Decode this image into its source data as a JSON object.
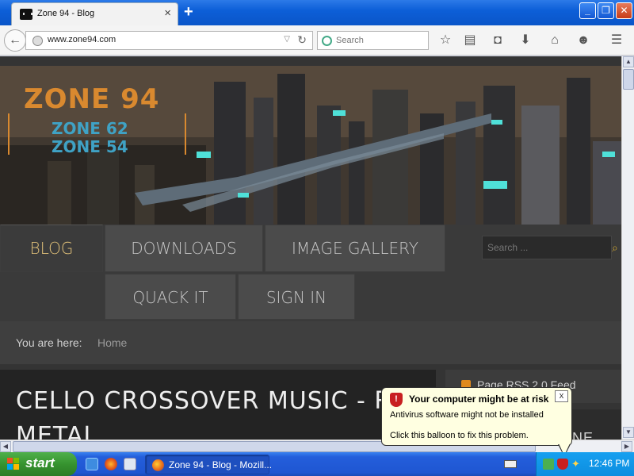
{
  "browser": {
    "tab_title": "Zone 94 - Blog",
    "tab_close": "×",
    "new_tab": "+",
    "url": "www.zone94.com",
    "search_placeholder": "Search",
    "window_buttons": {
      "minimize": "_",
      "maximize": "❐",
      "close": "✕"
    },
    "toolbar_icons": [
      "star-icon",
      "reading-list-icon",
      "pocket-icon",
      "download-icon",
      "home-icon",
      "smiley-icon",
      "menu-icon"
    ]
  },
  "site": {
    "logo": {
      "main": "ZONE 94",
      "sub1": "ZONE 62",
      "sub2": "ZONE 54"
    },
    "menu": {
      "row1": [
        "BLOG",
        "DOWNLOADS",
        "IMAGE GALLERY"
      ],
      "row2": [
        "QUACK IT",
        "SIGN IN"
      ],
      "active": "BLOG"
    },
    "search_placeholder": "Search ...",
    "breadcrumb": {
      "label": "You are here:",
      "current": "Home"
    },
    "article_title_line1": "CELLO CROSSOVER MUSIC - ROCK A",
    "article_title_line2": "METAL",
    "side_box": {
      "rss_text": "Page RSS 2.0 Feed"
    },
    "side_box2_text": "NE"
  },
  "balloon": {
    "title": "Your computer might be at risk",
    "line1": "Antivirus software might not be installed",
    "line2": "Click this balloon to fix this problem.",
    "close": "x"
  },
  "taskbar": {
    "start_label": "start",
    "task_label": "Zone 94 - Blog - Mozill...",
    "clock": "12:46 PM"
  },
  "colors": {
    "titlebar": "#0d5fd8",
    "active_menu": "#e2c27a",
    "logo_orange": "#d9892f",
    "logo_blue": "#3fa2c5",
    "balloon_bg": "#ffffe1"
  }
}
